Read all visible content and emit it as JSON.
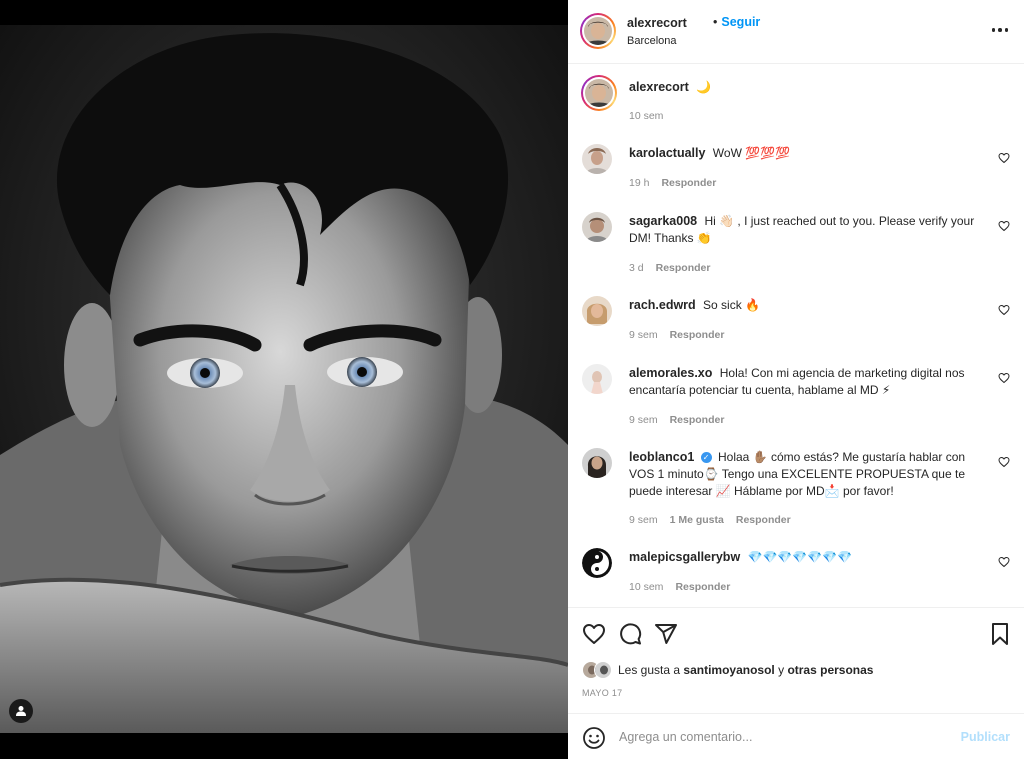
{
  "post": {
    "author": "alexrecort",
    "follow_separator": "•",
    "follow_label": "Seguir",
    "location": "Barcelona",
    "more_icon": "more-horizontal-icon"
  },
  "caption": {
    "username": "alexrecort",
    "text": "🌙",
    "time": "10 sem"
  },
  "comments": [
    {
      "username": "karolactually",
      "text": "WoW 💯💯💯",
      "time": "19 h",
      "likes": "",
      "reply": "Responder"
    },
    {
      "username": "sagarka008",
      "text": "Hi 👋🏻 , I just reached out to you. Please verify your DM! Thanks 👏",
      "time": "3 d",
      "likes": "",
      "reply": "Responder"
    },
    {
      "username": "rach.edwrd",
      "text": "So sick 🔥",
      "time": "9 sem",
      "likes": "",
      "reply": "Responder"
    },
    {
      "username": "alemorales.xo",
      "text": "Hola! Con mi agencia de marketing digital nos encantaría potenciar tu cuenta, hablame al MD ⚡",
      "time": "9 sem",
      "likes": "",
      "reply": "Responder"
    },
    {
      "username": "leoblanco1",
      "text": "Holaa ✋🏽 cómo estás? Me gustaría hablar con VOS 1 minuto⌚ Tengo una EXCELENTE PROPUESTA que te puede interesar 📈 Háblame por MD📩 por favor!",
      "time": "9 sem",
      "likes": "1 Me gusta",
      "reply": "Responder"
    },
    {
      "username": "malepicsgallerybw",
      "text": "💎💎💎💎💎💎💎",
      "time": "10 sem",
      "likes": "",
      "reply": "Responder"
    }
  ],
  "likes": {
    "prefix": "Les gusta a",
    "user": "santimoyanosol",
    "connector": "y",
    "others": "otras personas"
  },
  "date": "MAYO 17",
  "add_comment": {
    "placeholder": "Agrega un comentario...",
    "publish_label": "Publicar"
  },
  "colors": {
    "accent": "#0095f6",
    "publish_disabled": "#b2dffc",
    "muted": "#8e8e8e"
  }
}
